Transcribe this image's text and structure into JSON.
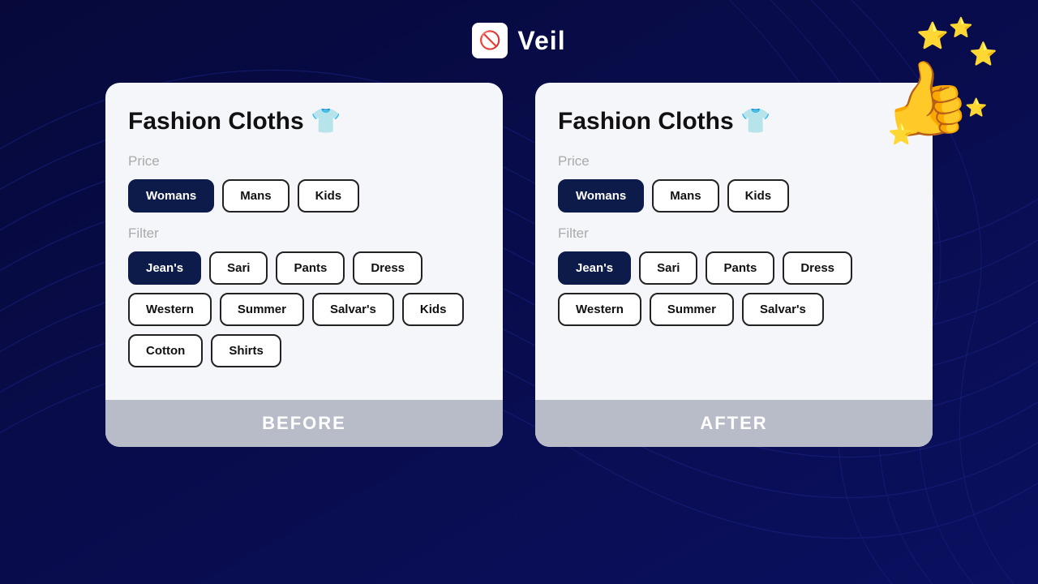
{
  "brand": {
    "logo_icon": "🚫👁",
    "name": "Veil"
  },
  "decoration": {
    "thumbs_up": "👍",
    "stars": [
      "⭐",
      "⭐",
      "⭐",
      "⭐",
      "⭐"
    ]
  },
  "cards": [
    {
      "id": "before",
      "title": "Fashion Cloths 👕",
      "price_label": "Price",
      "filter_label": "Filter",
      "price_buttons": [
        {
          "label": "Womans",
          "active": true
        },
        {
          "label": "Mans",
          "active": false
        },
        {
          "label": "Kids",
          "active": false
        }
      ],
      "filter_buttons": [
        {
          "label": "Jean's",
          "active": true
        },
        {
          "label": "Sari",
          "active": false
        },
        {
          "label": "Pants",
          "active": false
        },
        {
          "label": "Dress",
          "active": false
        },
        {
          "label": "Western",
          "active": false
        },
        {
          "label": "Summer",
          "active": false
        },
        {
          "label": "Salvar's",
          "active": false
        },
        {
          "label": "Kids",
          "active": false
        },
        {
          "label": "Cotton",
          "active": false
        },
        {
          "label": "Shirts",
          "active": false
        }
      ],
      "footer_label": "BEFORE"
    },
    {
      "id": "after",
      "title": "Fashion Cloths 👕",
      "price_label": "Price",
      "filter_label": "Filter",
      "price_buttons": [
        {
          "label": "Womans",
          "active": true
        },
        {
          "label": "Mans",
          "active": false
        },
        {
          "label": "Kids",
          "active": false
        }
      ],
      "filter_buttons": [
        {
          "label": "Jean's",
          "active": true
        },
        {
          "label": "Sari",
          "active": false
        },
        {
          "label": "Pants",
          "active": false
        },
        {
          "label": "Dress",
          "active": false
        },
        {
          "label": "Western",
          "active": false
        },
        {
          "label": "Summer",
          "active": false
        },
        {
          "label": "Salvar's",
          "active": false
        }
      ],
      "footer_label": "AFTER"
    }
  ]
}
